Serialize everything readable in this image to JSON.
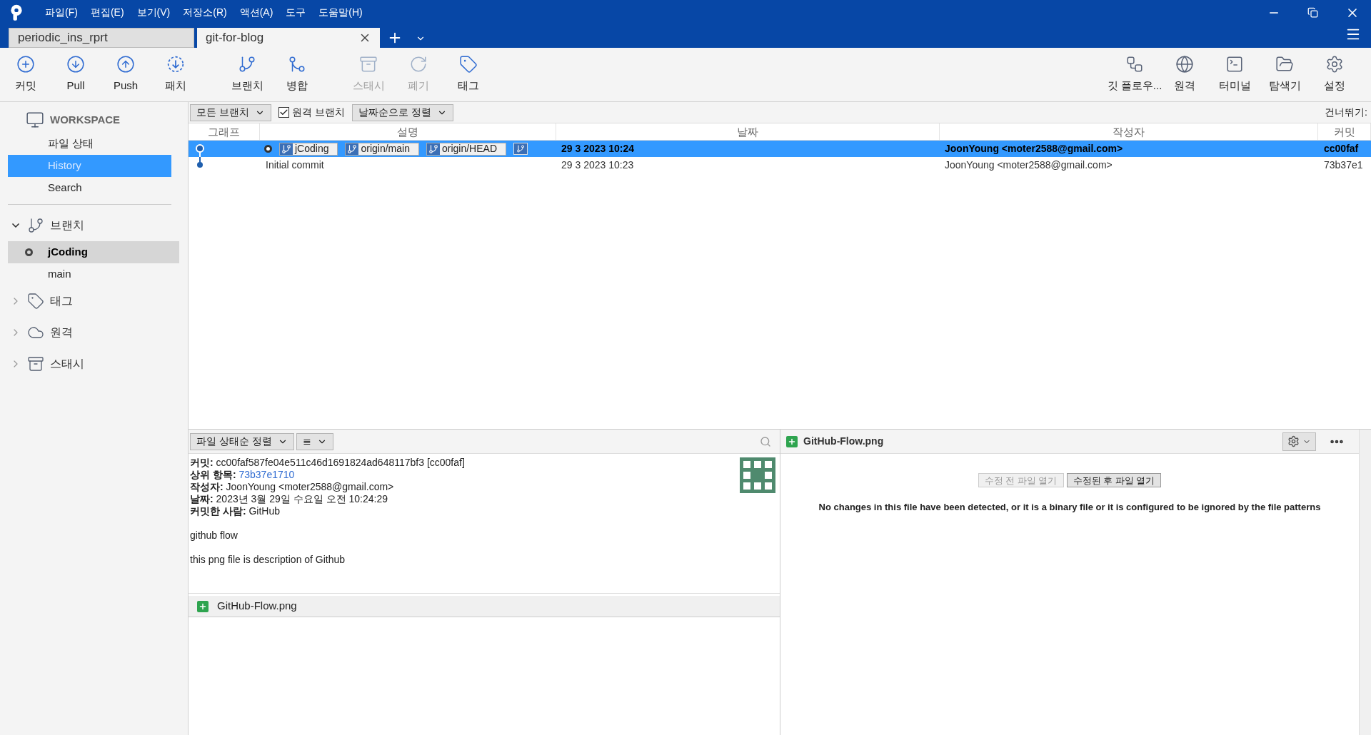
{
  "menu": [
    "파일(F)",
    "편집(E)",
    "보기(V)",
    "저장소(R)",
    "액션(A)",
    "도구",
    "도움말(H)"
  ],
  "tabs": [
    {
      "label": "periodic_ins_rprt",
      "selected": false,
      "closable": false
    },
    {
      "label": "git-for-blog",
      "selected": true,
      "closable": true
    }
  ],
  "toolbar_left": [
    {
      "kind": "commit",
      "label": "커밋",
      "disabled": false
    },
    {
      "kind": "pull",
      "label": "Pull",
      "disabled": false
    },
    {
      "kind": "push",
      "label": "Push",
      "disabled": false
    },
    {
      "kind": "patch",
      "label": "패치",
      "disabled": false
    },
    {
      "kind": "branch",
      "label": "브랜치",
      "disabled": false
    },
    {
      "kind": "merge",
      "label": "병합",
      "disabled": false
    },
    {
      "kind": "stash",
      "label": "스태시",
      "disabled": true
    },
    {
      "kind": "discard",
      "label": "폐기",
      "disabled": true
    },
    {
      "kind": "tag",
      "label": "태그",
      "disabled": false
    }
  ],
  "toolbar_right": [
    {
      "kind": "flow",
      "label": "깃 플로우..."
    },
    {
      "kind": "remote",
      "label": "원격"
    },
    {
      "kind": "terminal",
      "label": "터미널"
    },
    {
      "kind": "explorer",
      "label": "탐색기"
    },
    {
      "kind": "settings",
      "label": "설정"
    }
  ],
  "sidebar": {
    "workspace": {
      "title": "WORKSPACE",
      "items": [
        {
          "label": "파일 상태",
          "selected": false
        },
        {
          "label": "History",
          "selected": true
        },
        {
          "label": "Search",
          "selected": false
        }
      ]
    },
    "sections": [
      {
        "kind": "branch",
        "label": "브랜치",
        "expanded": true,
        "children": [
          {
            "label": "jCoding",
            "current": true
          },
          {
            "label": "main",
            "current": false
          }
        ]
      },
      {
        "kind": "tag",
        "label": "태그",
        "expanded": false
      },
      {
        "kind": "remote",
        "label": "원격",
        "expanded": false
      },
      {
        "kind": "stash",
        "label": "스태시",
        "expanded": false
      }
    ]
  },
  "filters": {
    "branches": "모든 브랜치",
    "remote_branches": {
      "label": "원격 브랜치",
      "checked": true
    },
    "sort": "날짜순으로 정렬",
    "skip": "건너뛰기:"
  },
  "table": {
    "columns": [
      "그래프",
      "설명",
      "날짜",
      "작성자",
      "커밋"
    ],
    "rows": [
      {
        "selected": true,
        "head": true,
        "refs": [
          "jCoding",
          "origin/main",
          "origin/HEAD"
        ],
        "more_refs": true,
        "description": "",
        "date": "29 3 2023 10:24",
        "author": "JoonYoung <moter2588@gmail.com>",
        "commit": "cc00faf"
      },
      {
        "selected": false,
        "head": false,
        "refs": [],
        "more_refs": false,
        "description": "Initial commit",
        "date": "29 3 2023 10:23",
        "author": "JoonYoung <moter2588@gmail.com>",
        "commit": "73b37e1"
      }
    ]
  },
  "details": {
    "sort": "파일 상태순 정렬",
    "view_icon": "≣",
    "fields": [
      {
        "label": "커밋:",
        "value": "cc00faf587fe04e511c46d1691824ad648117bf3 [cc00faf]",
        "link": false
      },
      {
        "label": "상위 항목:",
        "value": "73b37e1710",
        "link": true
      },
      {
        "label": "작성자:",
        "value": "JoonYoung <moter2588@gmail.com>",
        "link": false
      },
      {
        "label": "날짜:",
        "value": "2023년 3월 29일 수요일 오전 10:24:29",
        "link": false
      },
      {
        "label": "커밋한 사람:",
        "value": "GitHub",
        "link": false
      }
    ],
    "message": [
      "github flow",
      "this png file is description of Github"
    ],
    "files": [
      {
        "name": "GitHub-Flow.png",
        "added": true
      }
    ]
  },
  "diff": {
    "file": "GitHub-Flow.png",
    "added": true,
    "buttons": [
      {
        "label": "수정 전 파일 열기",
        "disabled": true
      },
      {
        "label": "수정된 후 파일 열기",
        "disabled": false
      }
    ],
    "message": "No changes in this file have been detected, or it is a binary file or it is configured to be ignored by the file patterns"
  }
}
